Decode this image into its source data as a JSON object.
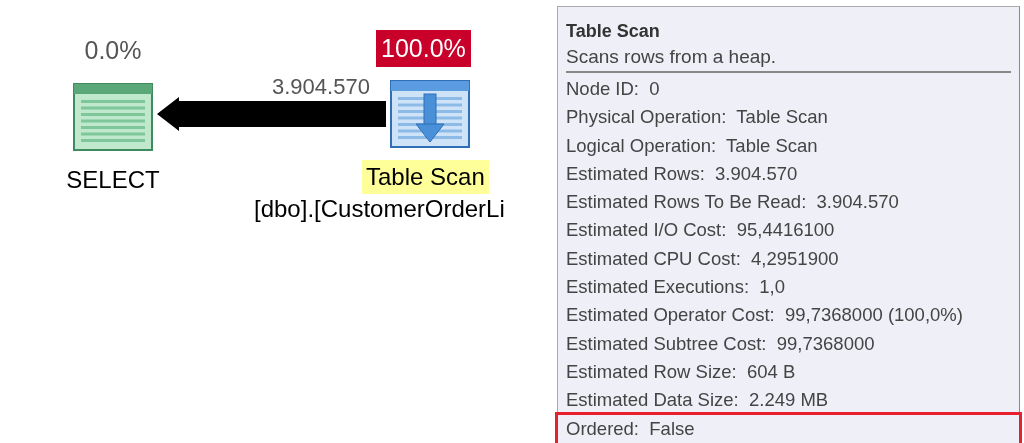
{
  "plan": {
    "nodes": [
      {
        "kind": "select",
        "cost": "0.0%",
        "cost_highlight": false,
        "label": "SELECT",
        "label_highlight": false
      },
      {
        "kind": "table_scan",
        "cost": "100.0%",
        "cost_highlight": true,
        "label": "Table Scan",
        "label_highlight": true,
        "object": "[dbo].[CustomerOrderLi"
      }
    ],
    "edge": {
      "rows": "3.904.570"
    }
  },
  "tooltip": {
    "title": "Table Scan",
    "description": "Scans rows from a heap.",
    "properties": [
      {
        "text": "Node ID:  0",
        "highlighted": false
      },
      {
        "text": "Physical Operation:  Table Scan",
        "highlighted": false
      },
      {
        "text": "Logical Operation:  Table Scan",
        "highlighted": false
      },
      {
        "text": "Estimated Rows:  3.904.570",
        "highlighted": false
      },
      {
        "text": "Estimated Rows To Be Read:  3.904.570",
        "highlighted": false
      },
      {
        "text": "Estimated I/O Cost:  95,4416100",
        "highlighted": false
      },
      {
        "text": "Estimated CPU Cost:  4,2951900",
        "highlighted": false
      },
      {
        "text": "Estimated Executions:  1,0",
        "highlighted": false
      },
      {
        "text": "Estimated Operator Cost:  99,7368000 (100,0%)",
        "highlighted": false
      },
      {
        "text": "Estimated Subtree Cost:  99,7368000",
        "highlighted": false
      },
      {
        "text": "Estimated Row Size:  604 B",
        "highlighted": false
      },
      {
        "text": "Estimated Data Size:  2.249 MB",
        "highlighted": false
      },
      {
        "text": "Ordered:  False",
        "highlighted": true
      }
    ]
  }
}
